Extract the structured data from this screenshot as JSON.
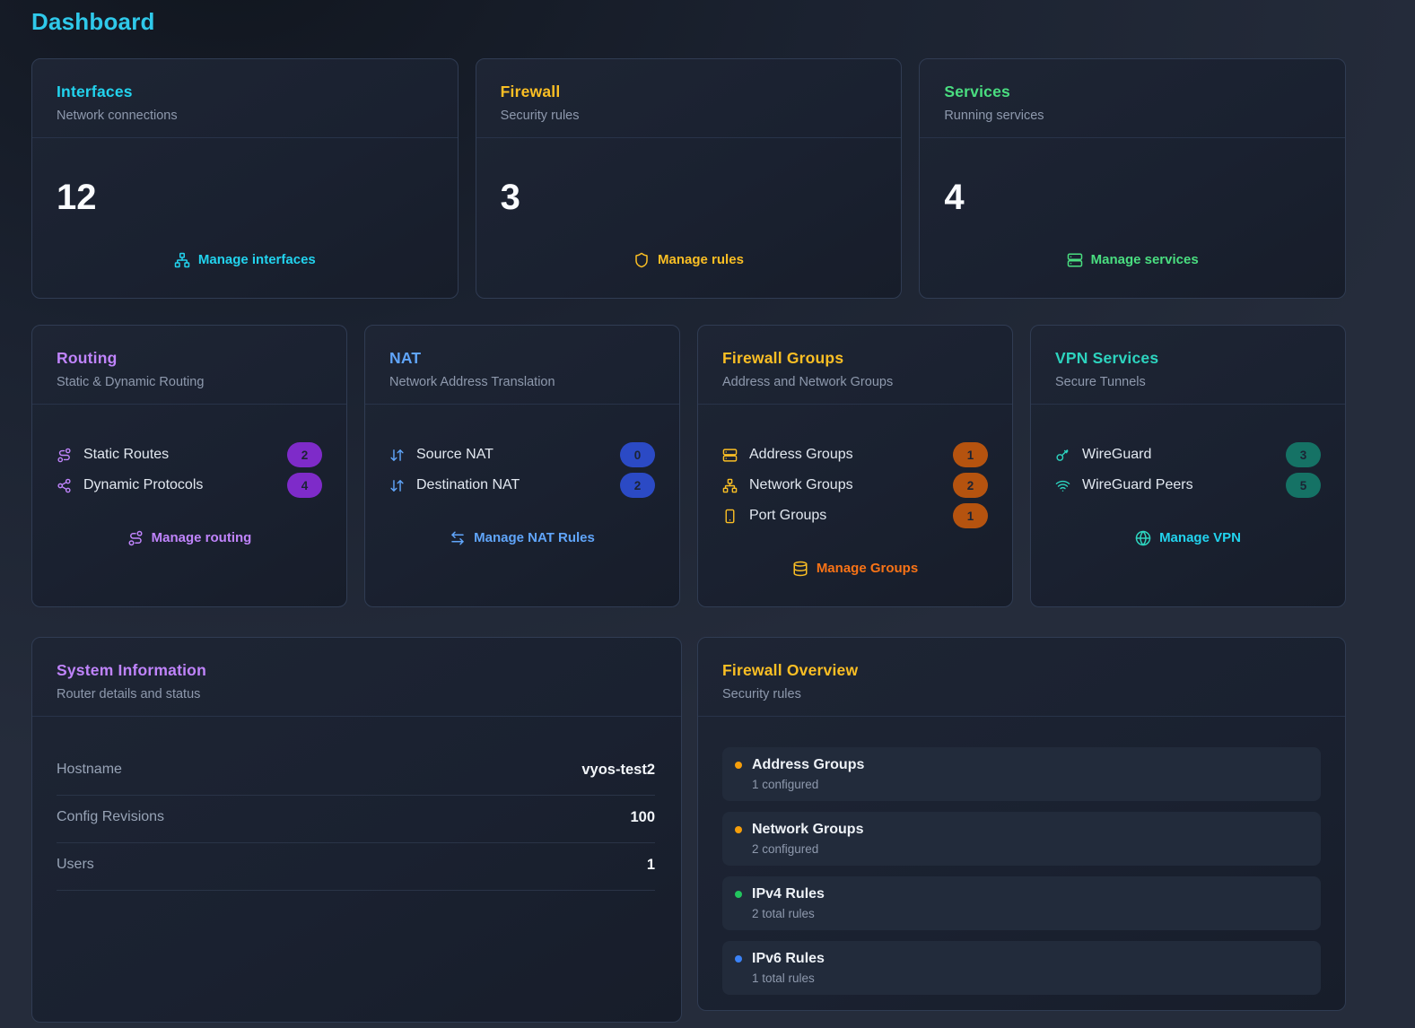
{
  "page": {
    "title": "Dashboard"
  },
  "stat_cards": [
    {
      "title": "Interfaces",
      "subtitle": "Network connections",
      "value": "12",
      "link_label": "Manage interfaces",
      "link_icon": "network-icon",
      "accent_color": "#22d3ee"
    },
    {
      "title": "Firewall",
      "subtitle": "Security rules",
      "value": "3",
      "link_label": "Manage rules",
      "link_icon": "shield-icon",
      "accent_color": "#fbbf24"
    },
    {
      "title": "Services",
      "subtitle": "Running services",
      "value": "4",
      "link_label": "Manage services",
      "link_icon": "server-icon",
      "accent_color": "#4ade80"
    }
  ],
  "feature_cards": [
    {
      "title": "Routing",
      "subtitle": "Static & Dynamic Routing",
      "accent_color": "#c084fc",
      "badge_color": "#7e2bc9",
      "rows": [
        {
          "icon": "route-icon",
          "label": "Static Routes",
          "count": "2"
        },
        {
          "icon": "share-nodes-icon",
          "label": "Dynamic Protocols",
          "count": "4"
        }
      ],
      "link": {
        "icon": "route-icon",
        "label": "Manage routing",
        "color": "#c084fc"
      }
    },
    {
      "title": "NAT",
      "subtitle": "Network Address Translation",
      "accent_color": "#60a5fa",
      "badge_color": "#2b4ac5",
      "rows": [
        {
          "icon": "arrow-down-up-icon",
          "label": "Source NAT",
          "count": "0"
        },
        {
          "icon": "arrow-down-up-icon",
          "label": "Destination NAT",
          "count": "2"
        }
      ],
      "link": {
        "icon": "arrow-left-right-icon",
        "label": "Manage NAT Rules",
        "color": "#60a5fa"
      }
    },
    {
      "title": "Firewall Groups",
      "subtitle": "Address and Network Groups",
      "accent_color": "#fbbf24",
      "badge_color": "#b5530f",
      "rows": [
        {
          "icon": "server-icon",
          "label": "Address Groups",
          "count": "1"
        },
        {
          "icon": "network-icon",
          "label": "Network Groups",
          "count": "2"
        },
        {
          "icon": "smartphone-icon",
          "label": "Port Groups",
          "count": "1"
        }
      ],
      "link": {
        "icon": "database-icon",
        "label": "Manage Groups",
        "color": "#f97316"
      }
    },
    {
      "title": "VPN Services",
      "subtitle": "Secure Tunnels",
      "accent_color": "#2dd4bf",
      "badge_color": "#157265",
      "rows": [
        {
          "icon": "key-icon",
          "label": "WireGuard",
          "count": "3"
        },
        {
          "icon": "wifi-icon",
          "label": "WireGuard Peers",
          "count": "5"
        }
      ],
      "link": {
        "icon": "globe-icon",
        "label": "Manage VPN",
        "color": "#22d3ee"
      }
    }
  ],
  "system_info": {
    "title": "System Information",
    "subtitle": "Router details and status",
    "accent_color": "#c084fc",
    "rows": [
      {
        "label": "Hostname",
        "value": "vyos-test2"
      },
      {
        "label": "Config Revisions",
        "value": "100"
      },
      {
        "label": "Users",
        "value": "1"
      }
    ]
  },
  "firewall_overview": {
    "title": "Firewall Overview",
    "subtitle": "Security rules",
    "accent_color": "#fbbf24",
    "items": [
      {
        "dot_color": "#f59e0b",
        "label": "Address Groups",
        "detail": "1 configured"
      },
      {
        "dot_color": "#f59e0b",
        "label": "Network Groups",
        "detail": "2 configured"
      },
      {
        "dot_color": "#22c55e",
        "label": "IPv4 Rules",
        "detail": "2 total rules"
      },
      {
        "dot_color": "#3b82f6",
        "label": "IPv6 Rules",
        "detail": "1 total rules"
      }
    ]
  }
}
